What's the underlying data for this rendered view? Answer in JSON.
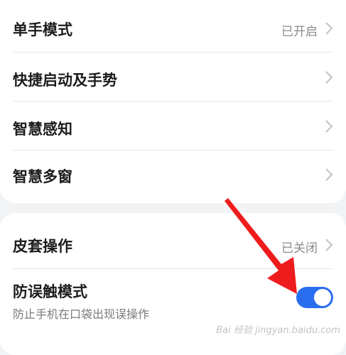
{
  "group1": {
    "items": [
      {
        "title": "单手模式",
        "value": "已开启"
      },
      {
        "title": "快捷启动及手势"
      },
      {
        "title": "智慧感知"
      },
      {
        "title": "智慧多窗"
      }
    ]
  },
  "group2": {
    "items": [
      {
        "title": "皮套操作",
        "value": "已关闭"
      },
      {
        "title": "防误触模式",
        "subtitle": "防止手机在口袋出现误操作",
        "toggle_on": true
      }
    ]
  },
  "watermark": "Bai 经验 jingyan.baidu.com",
  "icons": {
    "chevron": "chevron-right-icon",
    "arrow": "red-arrow-annotation"
  },
  "colors": {
    "toggle_on": "#2a6ef0",
    "arrow": "#ee1c1c",
    "background": "#f1f3f5",
    "card": "#ffffff"
  }
}
